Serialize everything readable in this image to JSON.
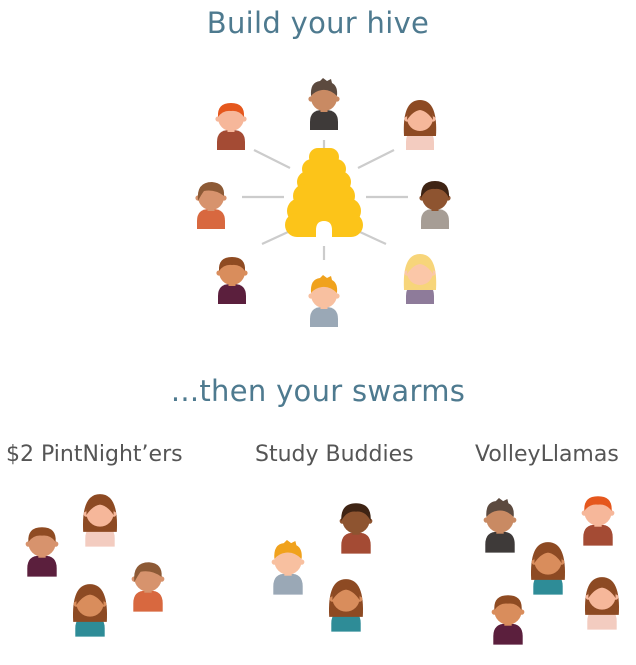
{
  "hive": {
    "title": "Build your hive",
    "center_icon": "beehive-icon",
    "members": [
      {
        "icon": "person-icon",
        "skin": "#f6b79a",
        "hair": "#e5571d",
        "hairStyle": "short",
        "shirt": "#a44b34"
      },
      {
        "icon": "person-icon",
        "skin": "#c98a63",
        "hair": "#5c4a3f",
        "hairStyle": "spiky",
        "shirt": "#3e3a39"
      },
      {
        "icon": "person-icon",
        "skin": "#f6b79a",
        "hair": "#8d4a23",
        "hairStyle": "long",
        "shirt": "#f3ccc0"
      },
      {
        "icon": "person-icon",
        "skin": "#d7936d",
        "hair": "#8d5a36",
        "hairStyle": "side",
        "shirt": "#d8683f"
      },
      {
        "icon": "person-icon",
        "skin": "#8e5430",
        "hair": "#3f2414",
        "hairStyle": "round",
        "shirt": "#a69d95"
      },
      {
        "icon": "person-icon",
        "skin": "#d98d5c",
        "hair": "#8f4b22",
        "hairStyle": "short",
        "shirt": "#5b1f3d"
      },
      {
        "icon": "person-icon",
        "skin": "#f8c0a0",
        "hair": "#f0a21d",
        "hairStyle": "spiky",
        "shirt": "#9aa8b6"
      },
      {
        "icon": "person-icon",
        "skin": "#fbc7a8",
        "hair": "#f7d57a",
        "hairStyle": "long",
        "shirt": "#8e7b9a"
      }
    ]
  },
  "swarms": {
    "title": "...then your swarms",
    "groups": [
      {
        "label": "$2 PintNight’ers",
        "members": [
          {
            "icon": "person-icon",
            "skin": "#d7936d",
            "hair": "#8f4b22",
            "hairStyle": "short",
            "shirt": "#5b1f3d"
          },
          {
            "icon": "person-icon",
            "skin": "#f6b79a",
            "hair": "#8d4a23",
            "hairStyle": "long",
            "shirt": "#f3ccc0"
          },
          {
            "icon": "person-icon",
            "skin": "#d7936d",
            "hair": "#8d5a36",
            "hairStyle": "side",
            "shirt": "#d8683f"
          },
          {
            "icon": "person-icon",
            "skin": "#d98d5c",
            "hair": "#8d4a23",
            "hairStyle": "long",
            "shirt": "#2e8c97"
          }
        ]
      },
      {
        "label": "Study Buddies",
        "members": [
          {
            "icon": "person-icon",
            "skin": "#f8c0a0",
            "hair": "#f0a21d",
            "hairStyle": "spiky",
            "shirt": "#9aa8b6"
          },
          {
            "icon": "person-icon",
            "skin": "#8e5430",
            "hair": "#3f2414",
            "hairStyle": "round",
            "shirt": "#a44b34"
          },
          {
            "icon": "person-icon",
            "skin": "#d98d5c",
            "hair": "#8d4a23",
            "hairStyle": "long",
            "shirt": "#2e8c97"
          }
        ]
      },
      {
        "label": "VolleyLlamas",
        "members": [
          {
            "icon": "person-icon",
            "skin": "#c98a63",
            "hair": "#5c4a3f",
            "hairStyle": "spiky",
            "shirt": "#3e3a39"
          },
          {
            "icon": "person-icon",
            "skin": "#f6b79a",
            "hair": "#e5571d",
            "hairStyle": "short",
            "shirt": "#a44b34"
          },
          {
            "icon": "person-icon",
            "skin": "#d98d5c",
            "hair": "#8d4a23",
            "hairStyle": "long",
            "shirt": "#2e8c97"
          },
          {
            "icon": "person-icon",
            "skin": "#d98d5c",
            "hair": "#8f4b22",
            "hairStyle": "short",
            "shirt": "#5b1f3d"
          },
          {
            "icon": "person-icon",
            "skin": "#f6b79a",
            "hair": "#8d4a23",
            "hairStyle": "long",
            "shirt": "#f3ccc0"
          }
        ]
      }
    ]
  },
  "colors": {
    "title": "#4e7a8f",
    "label": "#555555",
    "hive": "#fcc419",
    "connector": "#cccccc"
  }
}
